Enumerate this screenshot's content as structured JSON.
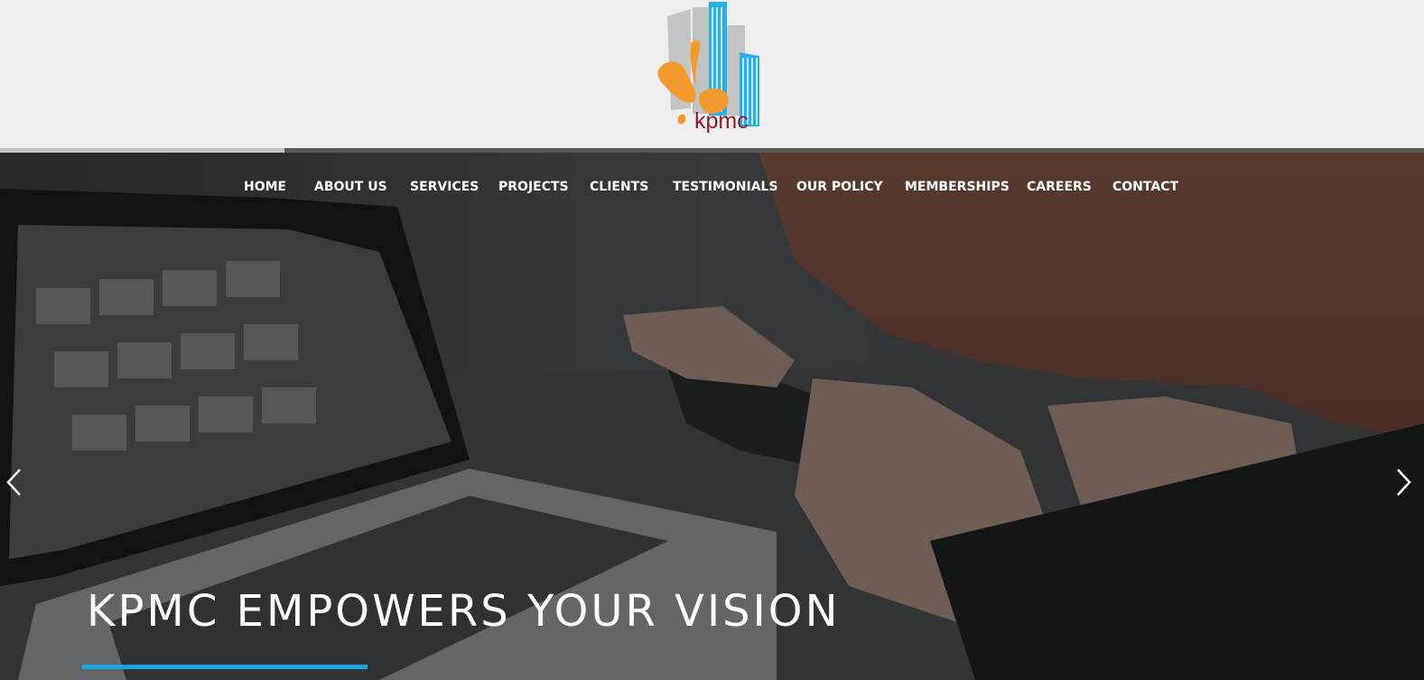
{
  "brand": {
    "logo_text": "kpmc",
    "logo_text_color": "#8e1d2a",
    "logo_orange": "#f39a2f",
    "logo_blue": "#2bb0e6",
    "logo_grey": "#b9b9b9"
  },
  "nav": {
    "items": [
      {
        "label": "HOME"
      },
      {
        "label": "ABOUT US"
      },
      {
        "label": "SERVICES"
      },
      {
        "label": "PROJECTS"
      },
      {
        "label": "CLIENTS"
      },
      {
        "label": "TESTIMONIALS"
      },
      {
        "label": "OUR POLICY"
      },
      {
        "label": "MEMBERSHIPS"
      },
      {
        "label": "CAREERS"
      },
      {
        "label": "CONTACT"
      }
    ]
  },
  "slider": {
    "progress_fraction": 0.2,
    "title": "KPMC EMPOWERS YOUR VISION",
    "prev_icon": "chevron-left-icon",
    "next_icon": "chevron-right-icon",
    "accent_color": "#15a7e0"
  }
}
